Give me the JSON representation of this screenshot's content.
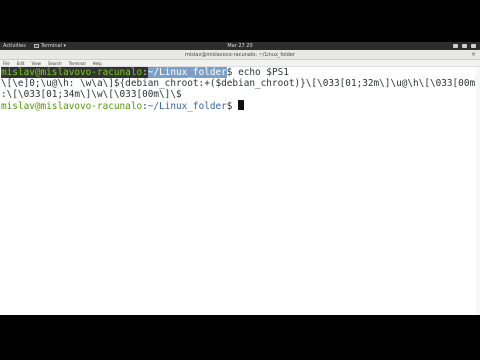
{
  "topbar": {
    "activities": "Activities",
    "terminal_app": "Terminal ▾",
    "clock": "Mar 27 20"
  },
  "window": {
    "title": "mislav@mislavovo-racunalo: ~/Linux_folder",
    "close_glyph": "×"
  },
  "menu": [
    "File",
    "Edit",
    "View",
    "Search",
    "Terminal",
    "Help"
  ],
  "terminal": {
    "prompt1": {
      "user": "mislav@mislavovo-racunalo",
      "colon": ":",
      "path": "~/Linux_folder",
      "suffix": "$ echo $PS1"
    },
    "output_line1": "\\[\\e]0;\\u@\\h: \\w\\a\\]${debian_chroot:+($debian_chroot)}\\[\\033[01;32m\\]\\u@\\h\\[\\033[00m\\]",
    "output_line2": ":\\[\\033[01;34m\\]\\w\\[\\033[00m\\]\\$",
    "prompt2": {
      "user": "mislav@mislavovo-racunalo",
      "colon": ":",
      "path": "~/Linux_folder",
      "suffix": "$ "
    }
  }
}
